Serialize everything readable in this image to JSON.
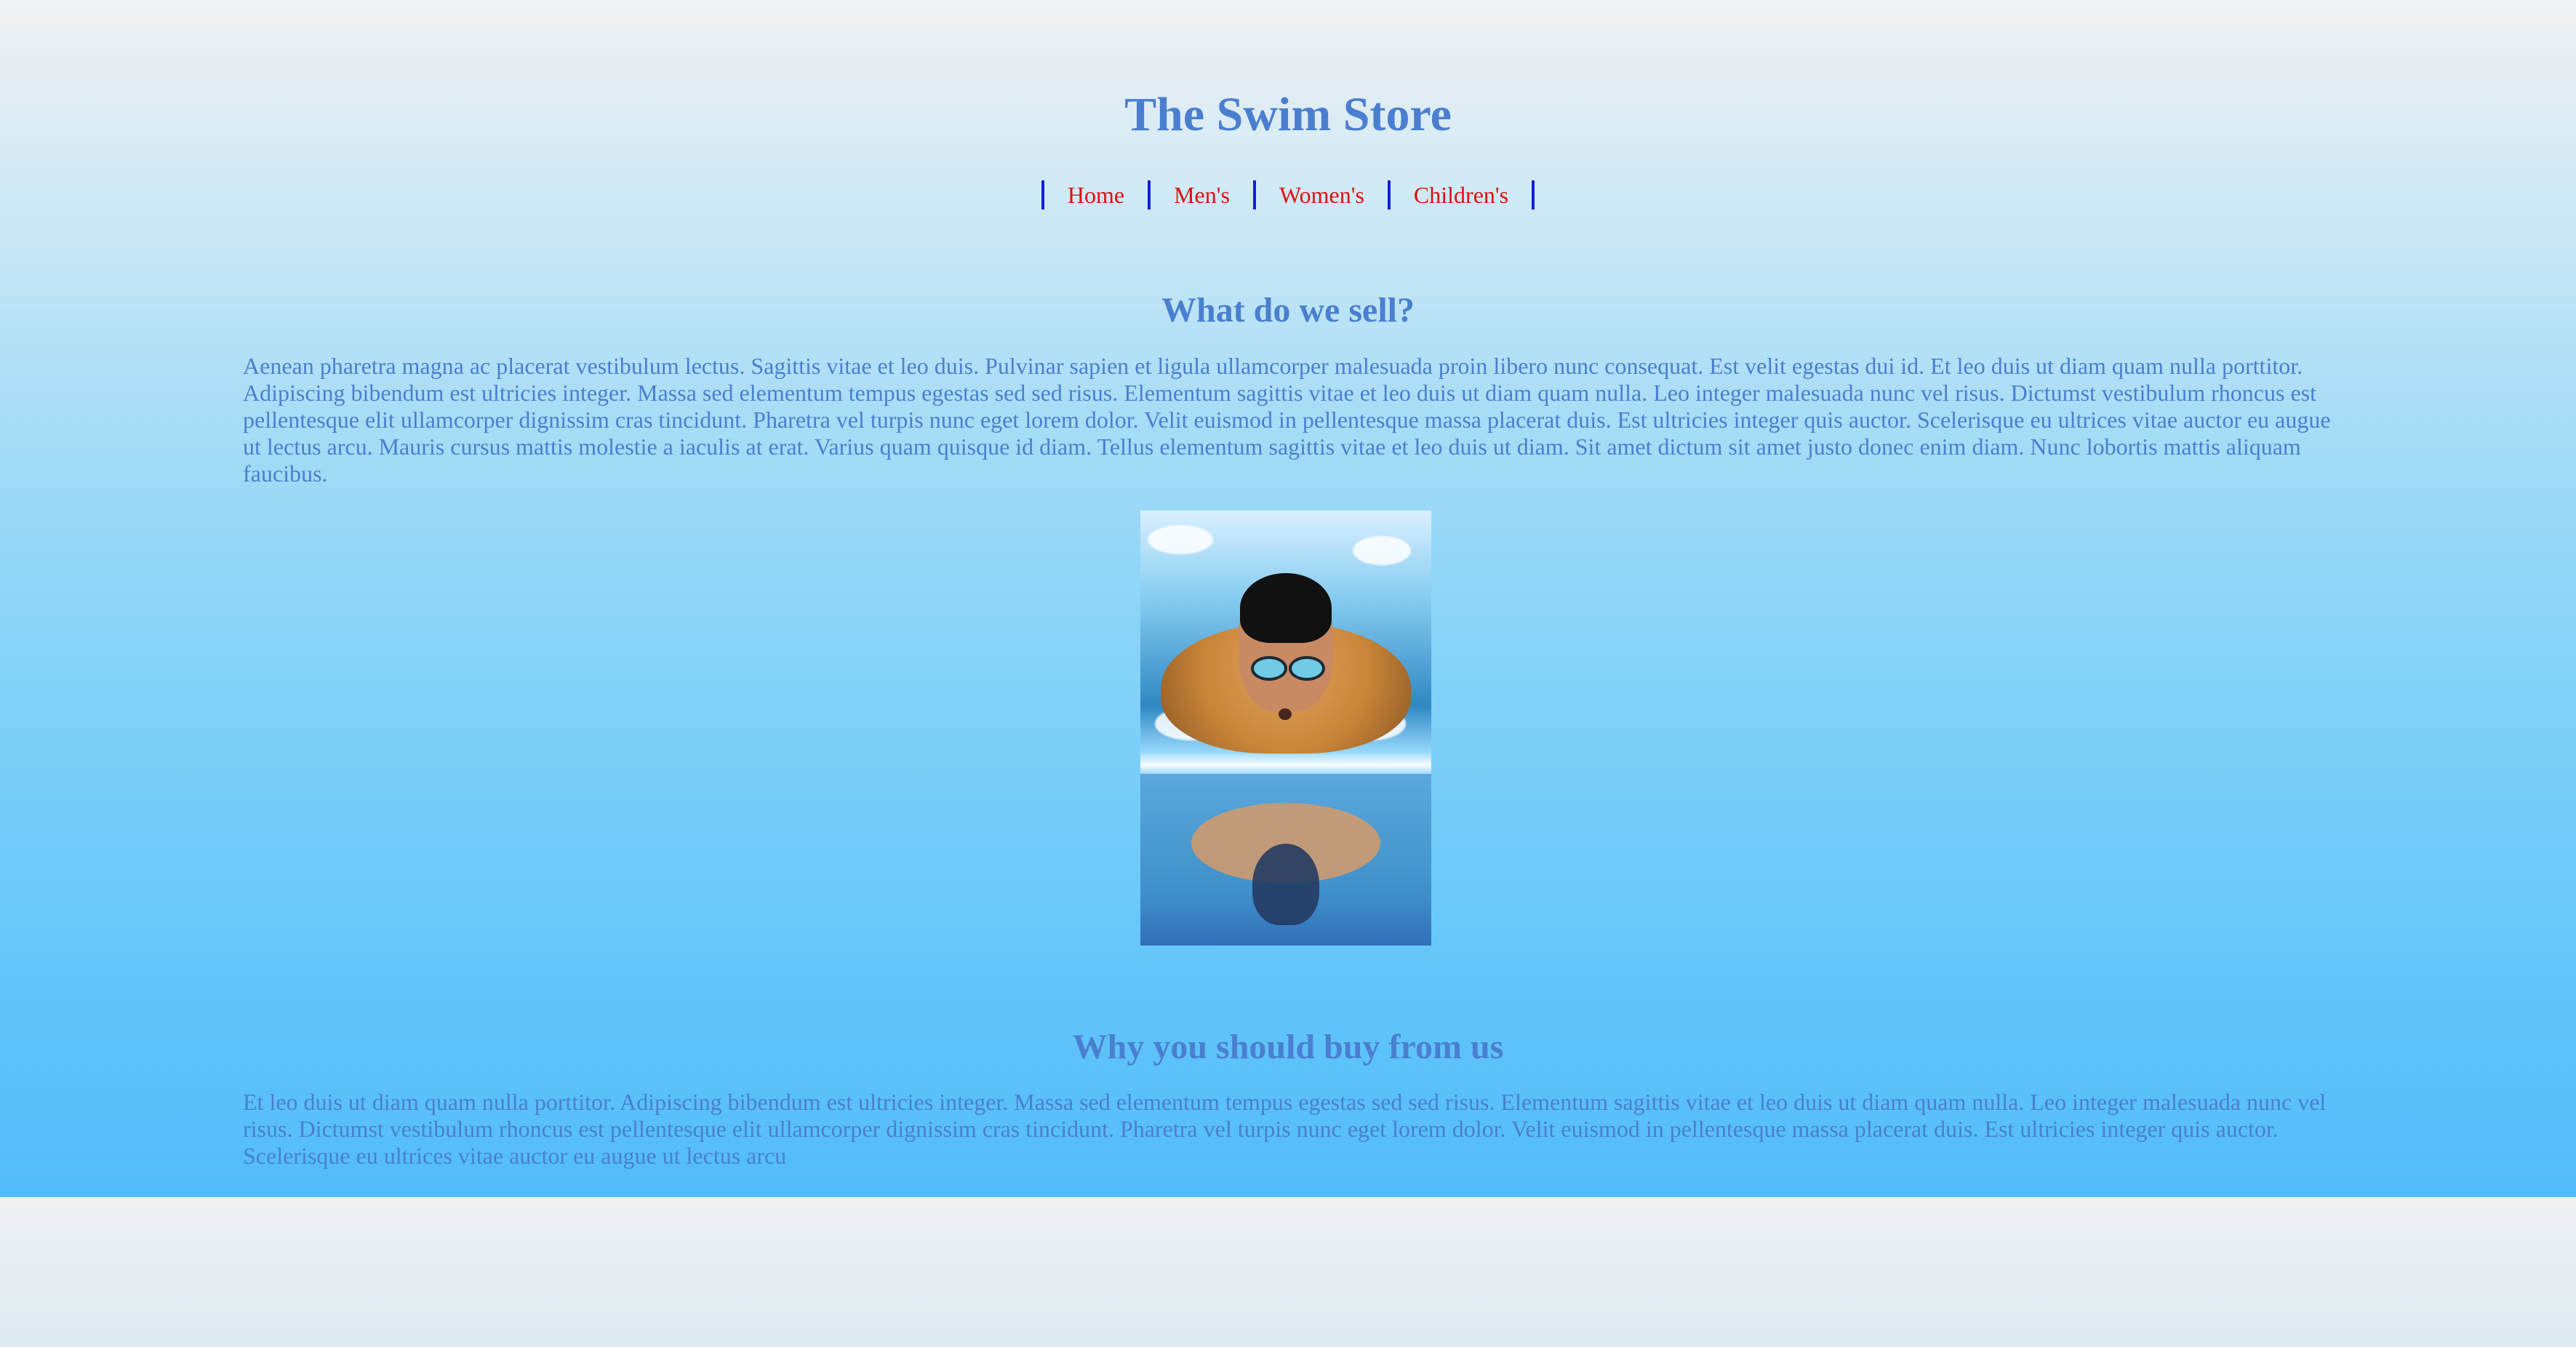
{
  "page": {
    "title": "The Swim Store"
  },
  "nav": {
    "items": [
      {
        "label": "Home"
      },
      {
        "label": "Men's"
      },
      {
        "label": "Women's"
      },
      {
        "label": "Children's"
      }
    ]
  },
  "sections": {
    "what": {
      "heading": "What do we sell?",
      "text": "Aenean pharetra magna ac placerat vestibulum lectus. Sagittis vitae et leo duis. Pulvinar sapien et ligula ullamcorper malesuada proin libero nunc consequat. Est velit egestas dui id. Et leo duis ut diam quam nulla porttitor. Adipiscing bibendum est ultricies integer. Massa sed elementum tempus egestas sed sed risus. Elementum sagittis vitae et leo duis ut diam quam nulla. Leo integer malesuada nunc vel risus. Dictumst vestibulum rhoncus est pellentesque elit ullamcorper dignissim cras tincidunt. Pharetra vel turpis nunc eget lorem dolor. Velit euismod in pellentesque massa placerat duis. Est ultricies integer quis auctor. Scelerisque eu ultrices vitae auctor eu augue ut lectus arcu. Mauris cursus mattis molestie a iaculis at erat. Varius quam quisque id diam. Tellus elementum sagittis vitae et leo duis ut diam. Sit amet dictum sit amet justo donec enim diam. Nunc lobortis mattis aliquam faucibus."
    },
    "why": {
      "heading": "Why you should buy from us",
      "text": "Et leo duis ut diam quam nulla porttitor. Adipiscing bibendum est ultricies integer. Massa sed elementum tempus egestas sed sed risus. Elementum sagittis vitae et leo duis ut diam quam nulla. Leo integer malesuada nunc vel risus. Dictumst vestibulum rhoncus est pellentesque elit ullamcorper dignissim cras tincidunt. Pharetra vel turpis nunc eget lorem dolor. Velit euismod in pellentesque massa placerat duis. Est ultricies integer quis auctor. Scelerisque eu ultrices vitae auctor eu augue ut lectus arcu"
    }
  },
  "image": {
    "icon": "swimmer-photo"
  },
  "colors": {
    "title": "#4a7fd0",
    "nav_link": "#df1010",
    "nav_divider": "#1020d8",
    "text": "#4a7fd0"
  }
}
